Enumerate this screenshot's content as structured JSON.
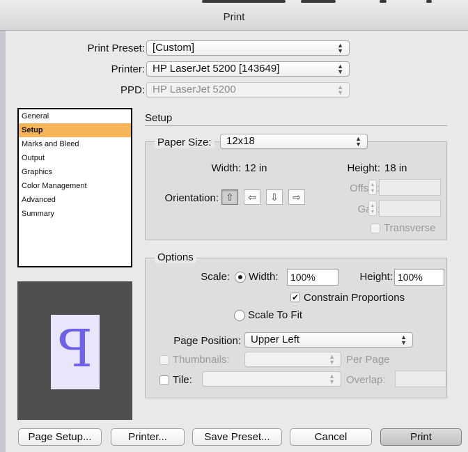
{
  "window": {
    "title": "Print"
  },
  "preset": {
    "label": "Print Preset:",
    "value": "[Custom]"
  },
  "printer": {
    "label": "Printer:",
    "value": "HP LaserJet 5200 [143649]"
  },
  "ppd": {
    "label": "PPD:",
    "value": "HP LaserJet 5200"
  },
  "sidebar": {
    "items": [
      {
        "label": "General"
      },
      {
        "label": "Setup"
      },
      {
        "label": "Marks and Bleed"
      },
      {
        "label": "Output"
      },
      {
        "label": "Graphics"
      },
      {
        "label": "Color Management"
      },
      {
        "label": "Advanced"
      },
      {
        "label": "Summary"
      }
    ],
    "selected": "Setup"
  },
  "preview": {
    "glyph": "P"
  },
  "setup": {
    "title": "Setup",
    "paper_size_label": "Paper Size:",
    "paper_size_value": "12x18",
    "width_label": "Width:",
    "width_value": "12 in",
    "height_label": "Height:",
    "height_value": "18 in",
    "offset_label": "Offset:",
    "offset_value": "",
    "gap_label": "Gap:",
    "gap_value": "",
    "orientation_label": "Orientation:",
    "orientations": [
      "portrait",
      "landscape",
      "reverse-portrait",
      "reverse-landscape"
    ],
    "orientation_selected": "portrait",
    "transverse_label": "Transverse",
    "transverse_checked": false
  },
  "options": {
    "title": "Options",
    "scale_label": "Scale:",
    "width_radio_label": "Width:",
    "width_value": "100%",
    "height_label": "Height:",
    "height_value": "100%",
    "constrain_label": "Constrain Proportions",
    "constrain_checked": true,
    "scale_to_fit_label": "Scale To Fit",
    "scale_mode": "width",
    "page_position_label": "Page Position:",
    "page_position_value": "Upper Left",
    "thumbnails_label": "Thumbnails:",
    "thumbnails_value": "",
    "per_page_label": "Per Page",
    "tile_label": "Tile:",
    "tile_value": "",
    "overlap_label": "Overlap:",
    "overlap_value": ""
  },
  "buttons": {
    "page_setup": "Page Setup...",
    "printer": "Printer...",
    "save_preset": "Save Preset...",
    "cancel": "Cancel",
    "print": "Print"
  },
  "colors": {
    "selection": "#f7b55a",
    "preview_bg": "#4f4f4f",
    "preview_paper": "#e9e6fb",
    "preview_glyph": "#6d61e6"
  }
}
